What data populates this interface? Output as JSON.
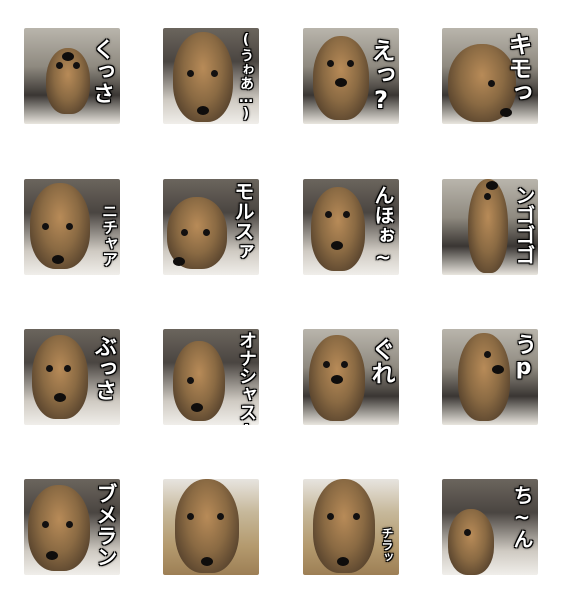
{
  "stickers": [
    {
      "caption": "くっさ"
    },
    {
      "caption": "(うゎあ…)"
    },
    {
      "caption": "えっ?"
    },
    {
      "caption": "キモっ"
    },
    {
      "caption": "ニチャア"
    },
    {
      "caption": "モルスァ"
    },
    {
      "caption": "んほぉ~"
    },
    {
      "caption": "ンゴゴゴ"
    },
    {
      "caption": "ぶっさ"
    },
    {
      "caption": "オナシャス!!"
    },
    {
      "caption": "ぐれ"
    },
    {
      "caption": "うp"
    },
    {
      "caption": "ブメラン"
    },
    {
      "caption": ""
    },
    {
      "caption": "チラッ"
    },
    {
      "caption": "ち~ん"
    }
  ]
}
